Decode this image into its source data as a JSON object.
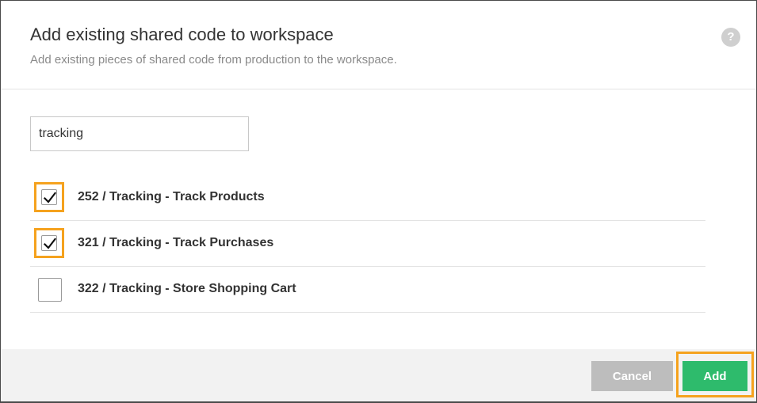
{
  "dialog": {
    "title": "Add existing shared code to workspace",
    "subtitle": "Add existing pieces of shared code from production to the workspace.",
    "help_label": "?"
  },
  "search": {
    "value": "tracking",
    "placeholder": ""
  },
  "items": [
    {
      "label": "252 / Tracking - Track Products",
      "checked": true
    },
    {
      "label": "321 / Tracking - Track Purchases",
      "checked": true
    },
    {
      "label": "322 / Tracking - Store Shopping Cart",
      "checked": false
    }
  ],
  "footer": {
    "cancel_label": "Cancel",
    "add_label": "Add"
  },
  "colors": {
    "accent_green": "#2ebb6c",
    "cancel_gray": "#bdbdbd",
    "highlight_orange": "#f5a21e"
  }
}
